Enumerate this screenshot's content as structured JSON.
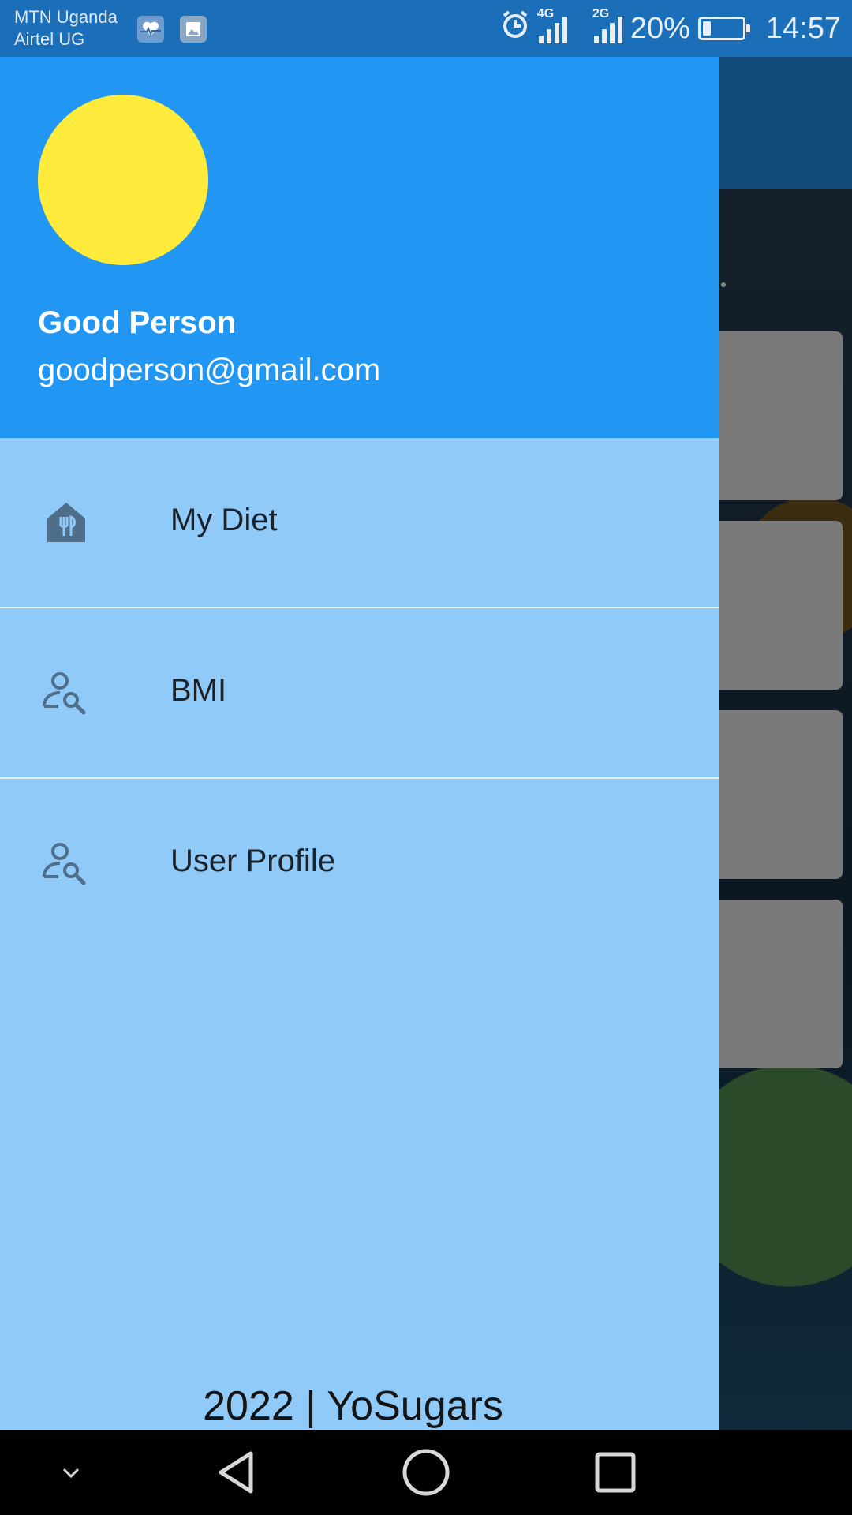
{
  "status_bar": {
    "carrier_1": "MTN Uganda",
    "carrier_2": "Airtel UG",
    "network_1": "4G",
    "network_2": "2G",
    "battery_percent": "20%",
    "battery_level": 0.2,
    "time": "14:57",
    "icons": [
      "health-monitor-icon",
      "gallery-icon",
      "alarm-icon",
      "signal-icon",
      "signal-icon",
      "battery-icon"
    ]
  },
  "drawer": {
    "header": {
      "user_name": "Good Person",
      "user_email": "goodperson@gmail.com",
      "avatar_color": "#ffeb3b",
      "background_color": "#2196f3"
    },
    "items": [
      {
        "label": "My Diet",
        "icon": "restaurant-icon"
      },
      {
        "label": "BMI",
        "icon": "person-search-icon"
      },
      {
        "label": "User Profile",
        "icon": "person-search-icon"
      }
    ],
    "background_color": "#90caf9",
    "footer": "2022 | YoSugars"
  },
  "nav_bar": {
    "buttons": [
      "collapse-icon",
      "back-icon",
      "home-icon",
      "recents-icon"
    ]
  }
}
